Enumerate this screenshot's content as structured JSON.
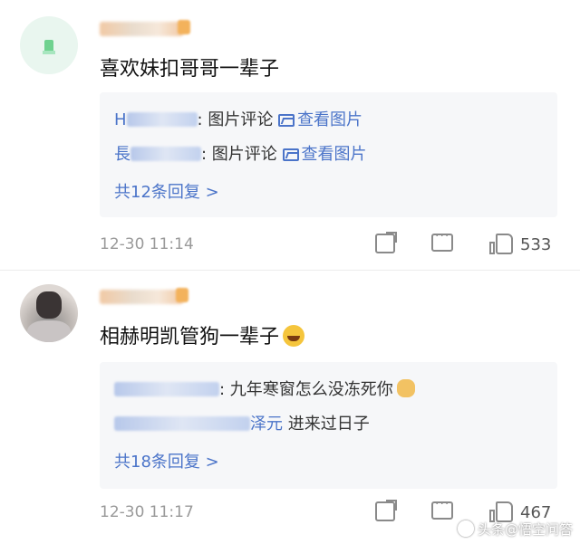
{
  "comments": [
    {
      "text": "喜欢妹扣哥哥一辈子",
      "replies": [
        {
          "user": "H",
          "text": ": 图片评论 ",
          "link": "查看图片"
        },
        {
          "user": "長",
          "text": ": 图片评论 ",
          "link": "查看图片"
        }
      ],
      "more": "共12条回复 >",
      "time": "12-30 11:14",
      "likes": "533",
      "icons": {
        "share": "share-icon",
        "comment": "comment-icon",
        "like": "like-icon"
      }
    },
    {
      "text": "相赫明凯管狗一辈子",
      "emoji": "laughing-face-emoji",
      "replies": [
        {
          "user": "",
          "text": ": 九年寒窗怎么没冻死你",
          "emoji": "dog-face-emoji"
        },
        {
          "user": "",
          "user_suffix": "泽元",
          "text": " 进来过日子"
        }
      ],
      "more": "共18条回复 >",
      "time": "12-30 11:17",
      "likes": "467"
    }
  ],
  "watermark": "头条@悟空问答"
}
